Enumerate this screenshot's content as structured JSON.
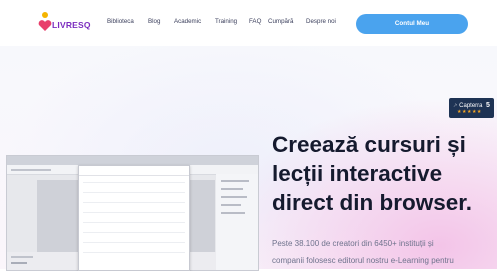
{
  "header": {
    "logo_text": "LIVRESQ",
    "nav": [
      "Biblioteca",
      "Blog",
      "Academic",
      "Training",
      "FAQ",
      "Cumpără",
      "Despre noi"
    ],
    "cta_label": "Contul Meu"
  },
  "badge": {
    "name": "Capterra",
    "score": "5",
    "stars": "★★★★★"
  },
  "hero": {
    "headline": [
      "Creează cursuri și",
      "lecții interactive",
      "direct din browser."
    ],
    "subtitle": [
      "Peste 38.100 de creatori din 6450+ instituții și",
      "companii folosesc editorul nostru e-Learning pentru"
    ]
  },
  "colors": {
    "brand": "#7b2cbf",
    "cta": "#4aa3ee",
    "headline": "#151a2e",
    "badge_bg": "#1e3354"
  }
}
